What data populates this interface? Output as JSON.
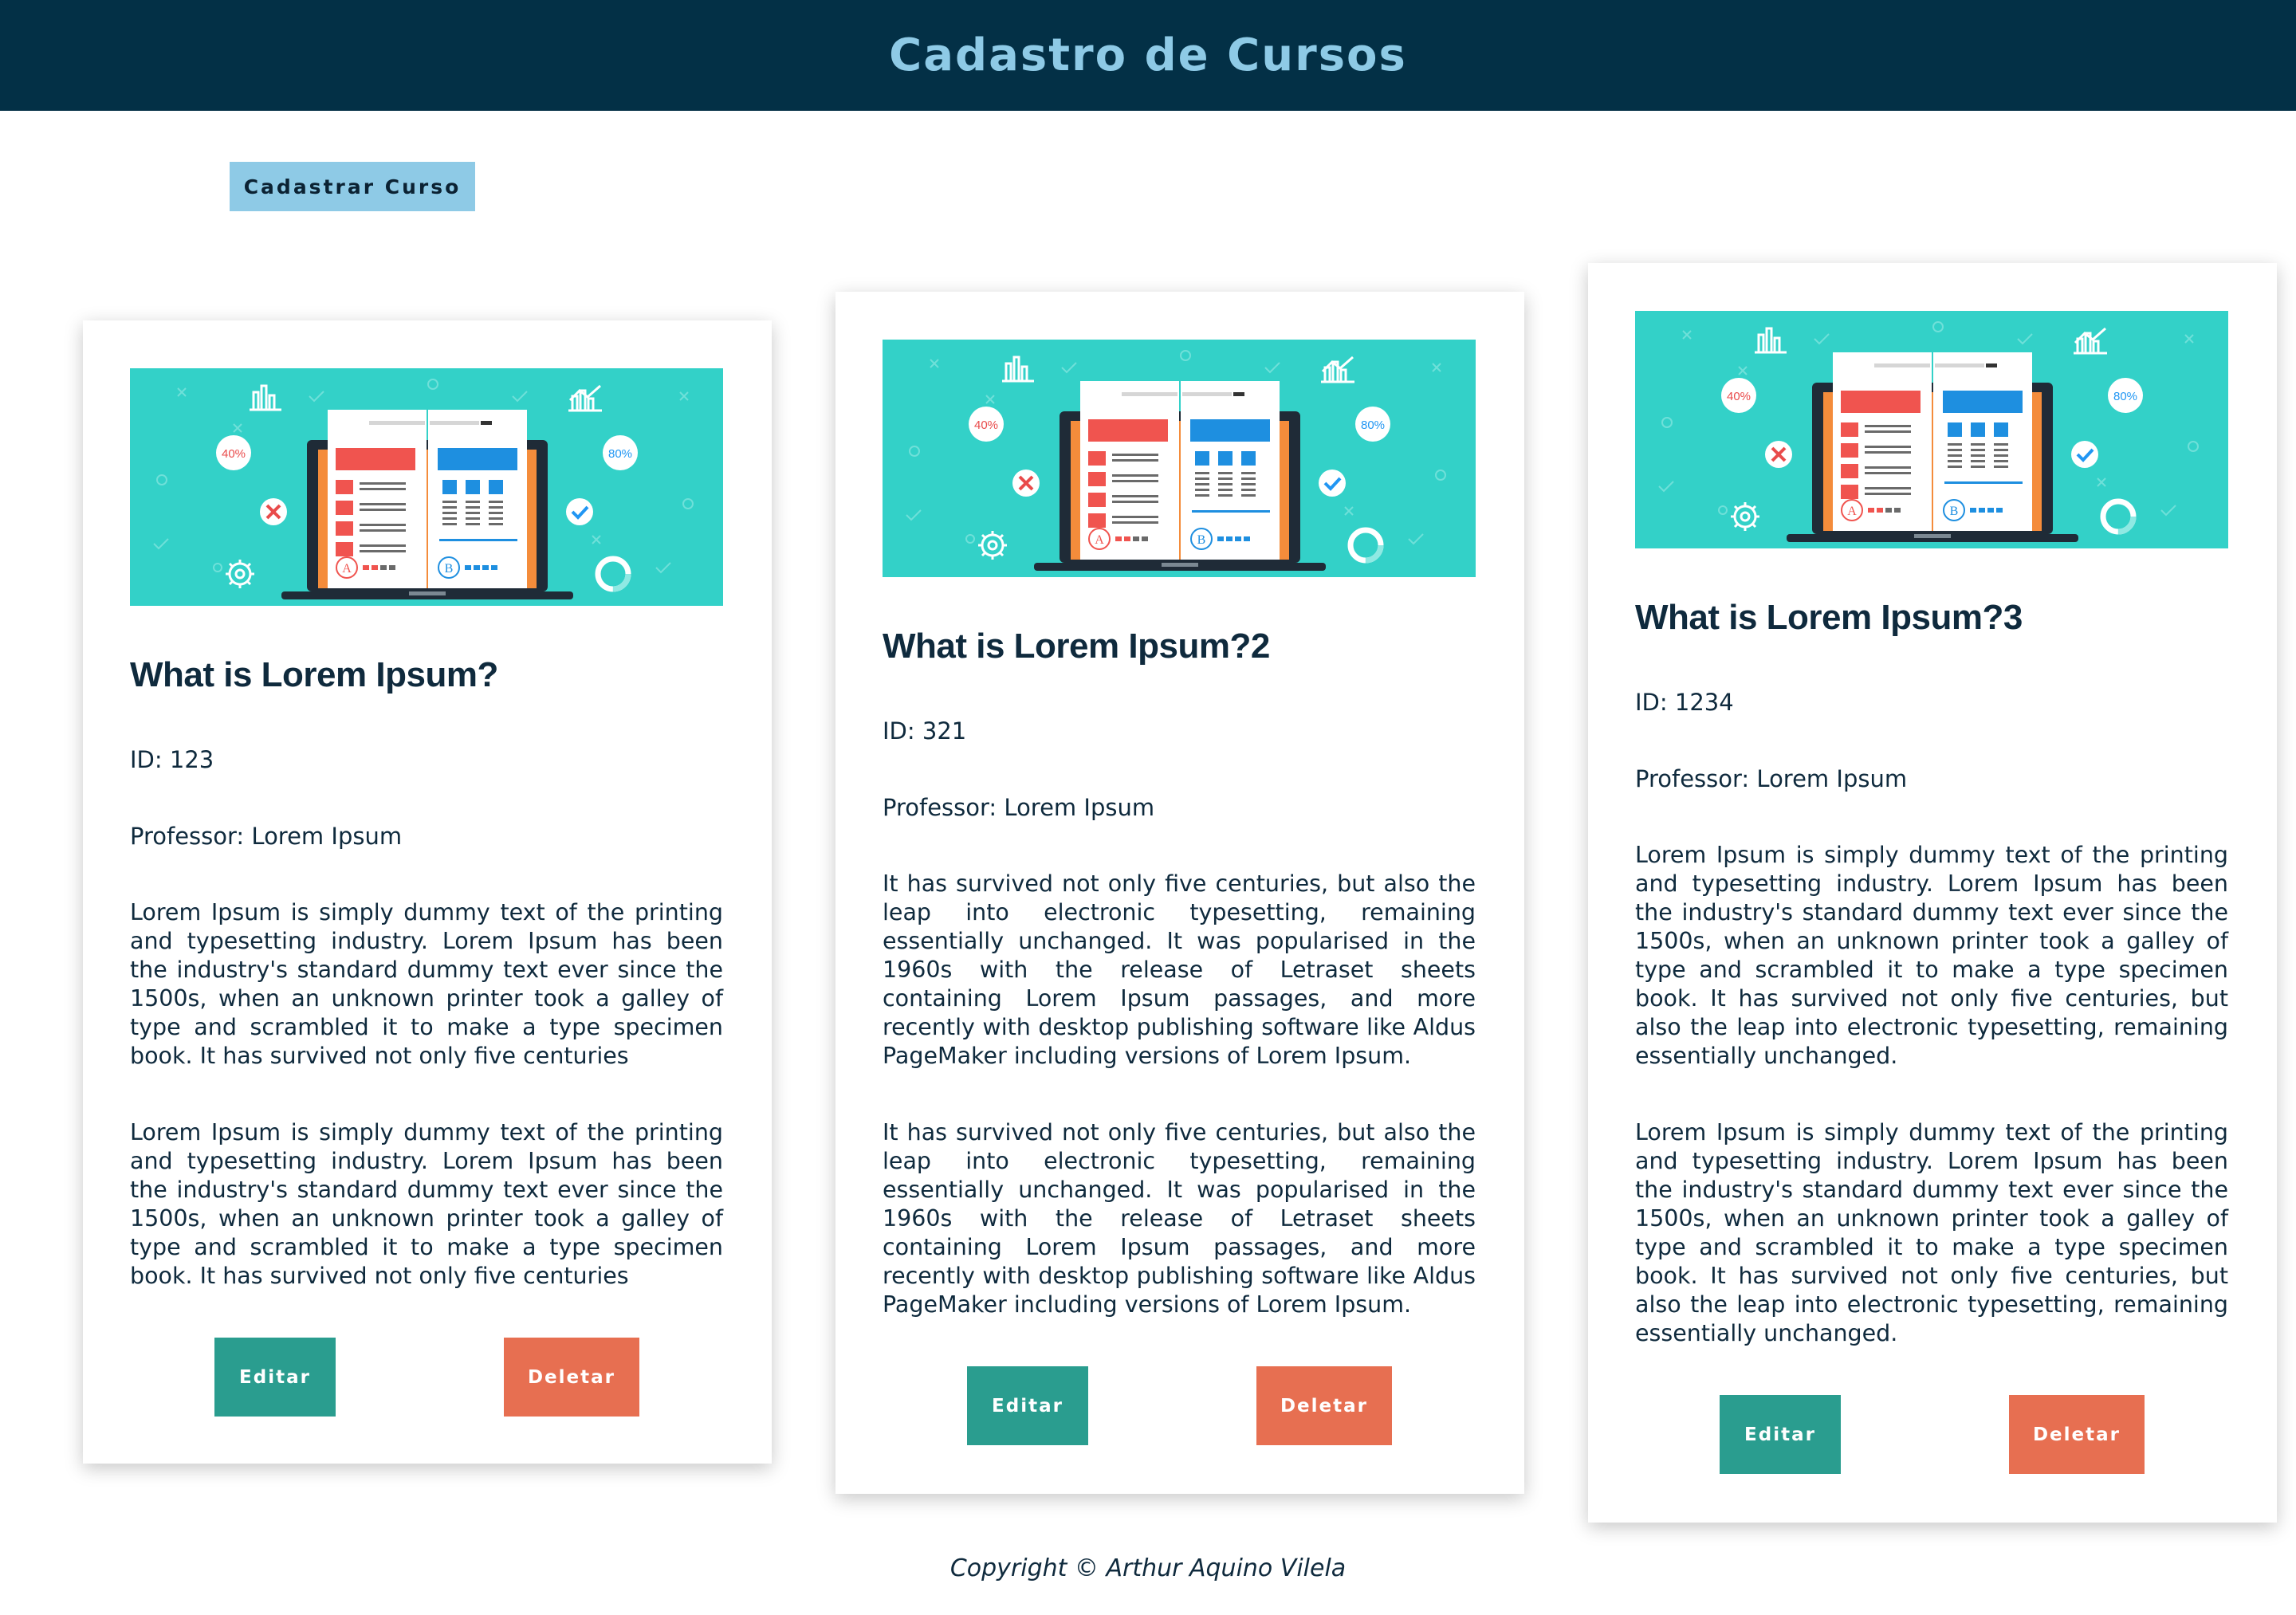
{
  "header": {
    "title": "Cadastro de Cursos"
  },
  "actions": {
    "register_label": "Cadastrar Curso"
  },
  "colors": {
    "header_bg": "#033046",
    "header_text": "#8ecae6",
    "primary_button": "#8ecae6",
    "edit_button": "#2a9d8f",
    "delete_button": "#e76f51",
    "banner_bg": "#33d1c8"
  },
  "courses": [
    {
      "title": "What is Lorem Ipsum?",
      "id_text": "ID: 123",
      "professor_text": "Professor: Lorem Ipsum",
      "paragraph1": "Lorem Ipsum is simply dummy text of the printing and typesetting industry. Lorem Ipsum has been the industry's standard dummy text ever since the 1500s, when an unknown printer took a galley of type and scrambled it to make a type specimen book. It has survived not only five centuries",
      "paragraph2": "Lorem Ipsum is simply dummy text of the printing and typesetting industry. Lorem Ipsum has been the industry's standard dummy text ever since the 1500s, when an unknown printer took a galley of type and scrambled it to make a type specimen book. It has survived not only five centuries",
      "edit_label": "Editar",
      "delete_label": "Deletar"
    },
    {
      "title": "What is Lorem Ipsum?2",
      "id_text": "ID: 321",
      "professor_text": "Professor: Lorem Ipsum",
      "paragraph1": "It has survived not only five centuries, but also the leap into electronic typesetting, remaining essentially unchanged. It was popularised in the 1960s with the release of Letraset sheets containing Lorem Ipsum passages, and more recently with desktop publishing software like Aldus PageMaker including versions of Lorem Ipsum.",
      "paragraph2": "It has survived not only five centuries, but also the leap into electronic typesetting, remaining essentially unchanged. It was popularised in the 1960s with the release of Letraset sheets containing Lorem Ipsum passages, and more recently with desktop publishing software like Aldus PageMaker including versions of Lorem Ipsum.",
      "edit_label": "Editar",
      "delete_label": "Deletar"
    },
    {
      "title": "What is Lorem Ipsum?3",
      "id_text": "ID: 1234",
      "professor_text": "Professor: Lorem Ipsum",
      "paragraph1": "Lorem Ipsum is simply dummy text of the printing and typesetting industry. Lorem Ipsum has been the industry's standard dummy text ever since the 1500s, when an unknown printer took a galley of type and scrambled it to make a type specimen book. It has survived not only five centuries, but also the leap into electronic typesetting, remaining essentially unchanged.",
      "paragraph2": "Lorem Ipsum is simply dummy text of the printing and typesetting industry. Lorem Ipsum has been the industry's standard dummy text ever since the 1500s, when an unknown printer took a galley of type and scrambled it to make a type specimen book. It has survived not only five centuries, but also the leap into electronic typesetting, remaining essentially unchanged.",
      "edit_label": "Editar",
      "delete_label": "Deletar"
    }
  ],
  "footer": {
    "copyright": "Copyright © Arthur Aquino Vilela"
  }
}
